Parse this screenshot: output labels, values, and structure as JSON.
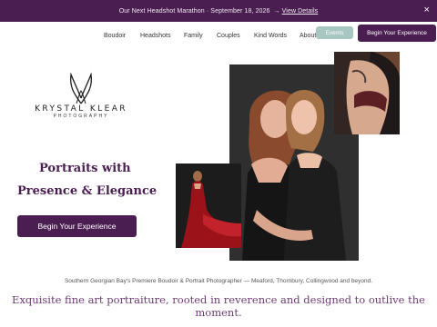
{
  "announcement": {
    "text": "Our Next Headshot Marathon · September 18, 2026",
    "link": "View Details",
    "close": "×"
  },
  "nav": {
    "items": [
      "Boudoir",
      "Headshots",
      "Family",
      "Couples",
      "Kind Words",
      "About"
    ],
    "events_label": "Events",
    "begin_label": "Begin Your Experience"
  },
  "logo": {
    "name": "KRYSTAL KLEAR",
    "sub": "PHOTOGRAPHY"
  },
  "hero": {
    "line1": "Portraits with",
    "line2": "Presence & Elegance",
    "cta": "Begin Your Experience"
  },
  "footer": {
    "tagline": "Southern Georgian Bay's Premiere Boudoir & Portrait Photographer — Meaford, Thornbury, Collingwood and beyond.",
    "subhead": "Exquisite fine art portraiture, rooted in reverence and designed to outlive the moment."
  },
  "colors": {
    "brand": "#4b1e52",
    "accent": "#a9c7c2"
  }
}
